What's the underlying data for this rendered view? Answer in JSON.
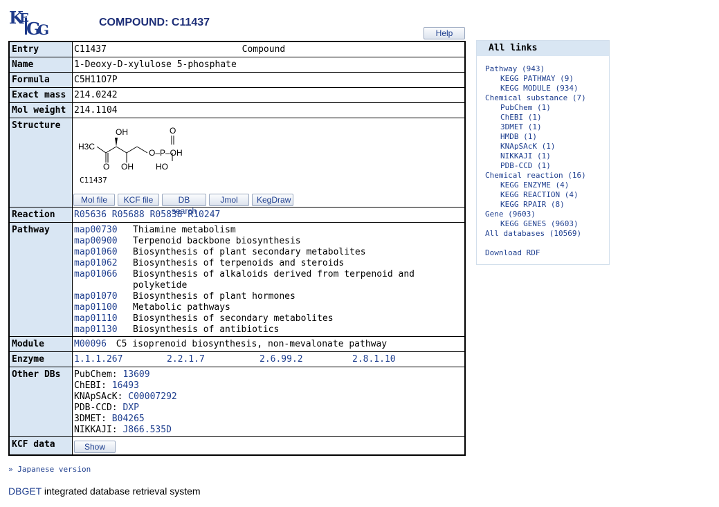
{
  "header": {
    "title": "COMPOUND: C11437",
    "help_label": "Help"
  },
  "entry": {
    "label": "Entry",
    "id": "C11437",
    "type": "Compound"
  },
  "name": {
    "label": "Name",
    "value": "1-Deoxy-D-xylulose 5-phosphate"
  },
  "formula": {
    "label": "Formula",
    "value": "C5H11O7P"
  },
  "exact_mass": {
    "label": "Exact mass",
    "value": "214.0242"
  },
  "mol_weight": {
    "label": "Mol weight",
    "value": "214.1104"
  },
  "structure": {
    "label": "Structure",
    "image_id": "C11437",
    "atoms": {
      "oh_top": "OH",
      "h3c": "H3C",
      "o_left": "O",
      "oh_bottom": "OH",
      "o_p_oh": "O–P–OH",
      "o_top": "O",
      "ho": "HO"
    },
    "buttons": [
      "Mol file",
      "KCF file",
      "DB search",
      "Jmol",
      "KegDraw"
    ]
  },
  "reaction": {
    "label": "Reaction",
    "items": [
      "R05636",
      "R05688",
      "R05838",
      "R10247"
    ]
  },
  "pathway": {
    "label": "Pathway",
    "items": [
      {
        "id": "map00730",
        "name": "Thiamine metabolism"
      },
      {
        "id": "map00900",
        "name": "Terpenoid backbone biosynthesis"
      },
      {
        "id": "map01060",
        "name": "Biosynthesis of plant secondary metabolites"
      },
      {
        "id": "map01062",
        "name": "Biosynthesis of terpenoids and steroids"
      },
      {
        "id": "map01066",
        "name": "Biosynthesis of alkaloids derived from terpenoid and polyketide"
      },
      {
        "id": "map01070",
        "name": "Biosynthesis of plant hormones"
      },
      {
        "id": "map01100",
        "name": "Metabolic pathways"
      },
      {
        "id": "map01110",
        "name": "Biosynthesis of secondary metabolites"
      },
      {
        "id": "map01130",
        "name": "Biosynthesis of antibiotics"
      }
    ]
  },
  "module": {
    "label": "Module",
    "id": "M00096",
    "name": "C5 isoprenoid biosynthesis, non-mevalonate pathway"
  },
  "enzyme": {
    "label": "Enzyme",
    "items": [
      "1.1.1.267",
      "2.2.1.7",
      "2.6.99.2",
      "2.8.1.10"
    ]
  },
  "other_dbs": {
    "label": "Other DBs",
    "items": [
      {
        "db": "PubChem:",
        "id": "13609"
      },
      {
        "db": "ChEBI:",
        "id": "16493"
      },
      {
        "db": "KNApSAcK:",
        "id": "C00007292"
      },
      {
        "db": "PDB-CCD:",
        "id": "DXP"
      },
      {
        "db": "3DMET:",
        "id": "B04265"
      },
      {
        "db": "NIKKAJI:",
        "id": "J866.535D"
      }
    ]
  },
  "kcf": {
    "label": "KCF data",
    "button": "Show"
  },
  "all_links": {
    "header": "All links",
    "groups": [
      {
        "name": "Pathway (943)",
        "subs": [
          "KEGG PATHWAY (9)",
          "KEGG MODULE (934)"
        ]
      },
      {
        "name": "Chemical substance (7)",
        "subs": [
          "PubChem (1)",
          "ChEBI (1)",
          "3DMET (1)",
          "HMDB (1)",
          "KNApSAcK (1)",
          "NIKKAJI (1)",
          "PDB-CCD (1)"
        ]
      },
      {
        "name": "Chemical reaction (16)",
        "subs": [
          "KEGG ENZYME (4)",
          "KEGG REACTION (4)",
          "KEGG RPAIR (8)"
        ]
      },
      {
        "name": "Gene (9603)",
        "subs": [
          "KEGG GENES (9603)"
        ]
      },
      {
        "name": "All databases (10569)",
        "subs": []
      }
    ],
    "download": "Download RDF"
  },
  "japanese_link": "» Japanese version",
  "footer": {
    "link": "DBGET",
    "text": " integrated database retrieval system"
  },
  "colors": {
    "label_bg": "#d9e6f3",
    "link": "#1f3f8f",
    "title": "#1e2f78"
  }
}
